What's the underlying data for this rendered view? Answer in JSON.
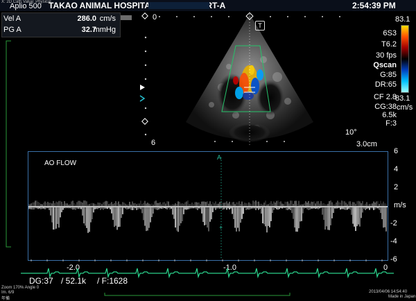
{
  "header": {
    "left_tiny": "X: 2D Cath Value: Physical",
    "system": "Aplio 500",
    "hospital": "TAKAO ANIMAL HOSPITAL",
    "study": "HEART-A",
    "time": "2:54:39 PM"
  },
  "measurements": [
    {
      "label": "Vel  A",
      "value": "286.0",
      "unit": "cm/s"
    },
    {
      "label": "PG  A",
      "value": "32.7",
      "unit": "mmHg"
    }
  ],
  "image": {
    "depth_top": "0",
    "depth_bottom": "6",
    "angle": "10°",
    "scale": "3.0cm",
    "marker": "T"
  },
  "params": [
    "6S3",
    "T6.2",
    "30 fps",
    "Qscan",
    "G:85",
    "DR:65",
    "CF 2.8",
    "CG:38",
    "6.5k",
    "F:3"
  ],
  "colorbar": {
    "top": "83.1",
    "bottom": "83.1",
    "unit": "cm/s",
    "colors": [
      "#ffe000",
      "#ff5000",
      "#a00000",
      "#000000",
      "#0040c0",
      "#00c0ff",
      "#a0ffff"
    ]
  },
  "doppler": {
    "label": "AO FLOW",
    "cursor_label": "A",
    "unit": "m/s",
    "yticks": [
      "6",
      "4",
      "2",
      "0",
      "-2",
      "-4",
      "-6"
    ],
    "xticks": [
      "-2.0",
      "-1.0",
      "0"
    ]
  },
  "footer": {
    "dg": "DG:37",
    "prf": "/ 52.1k",
    "f": "/ F:1628",
    "zoom": "Zoom  170%  Angle  0",
    "line2": "Im. 6/9",
    "line3": "年備",
    "date": "2013/04/06 14:54:40",
    "made": "Made in Japan"
  }
}
